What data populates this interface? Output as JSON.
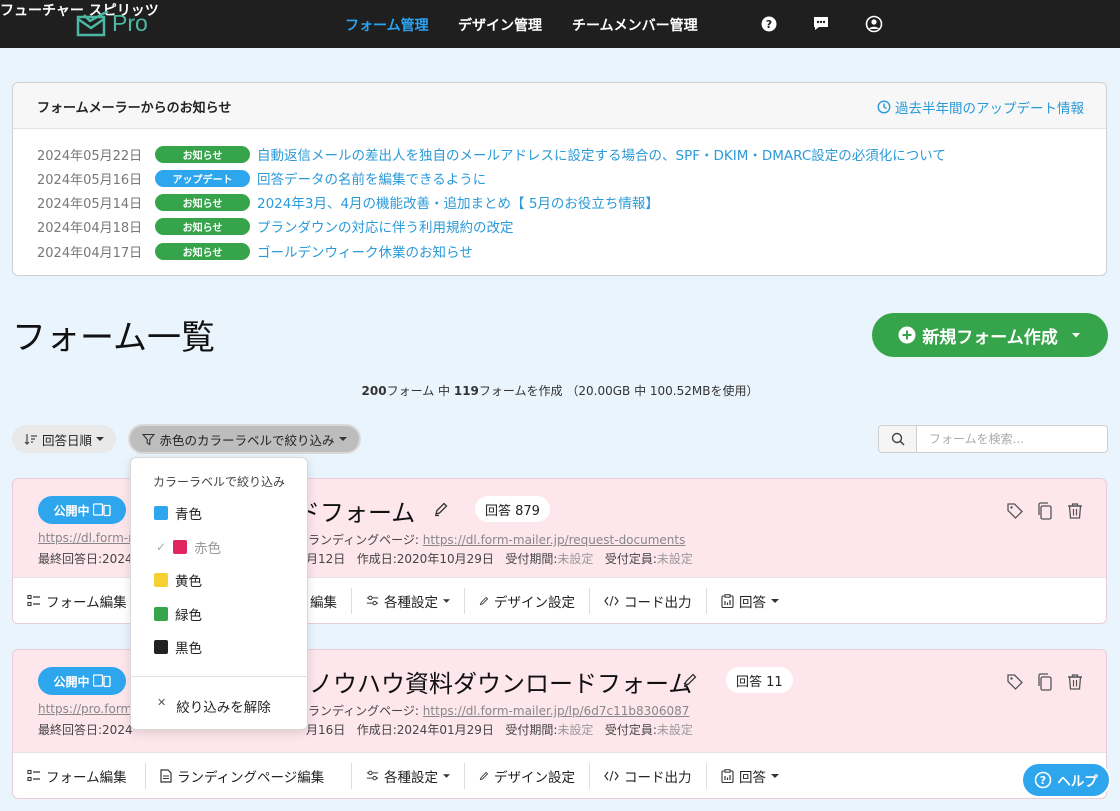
{
  "nav": {
    "logo_text": "Pro",
    "items": [
      "フォーム管理",
      "デザイン管理",
      "チームメンバー管理"
    ],
    "user_name": "フューチャー スピリッツ"
  },
  "news": {
    "title": "フォームメーラーからのお知らせ",
    "history_link": "過去半年間のアップデート情報",
    "items": [
      {
        "date": "2024年05月22日",
        "badge": "お知らせ",
        "text": "自動返信メールの差出人を独自のメールアドレスに設定する場合の、SPF・DKIM・DMARC設定の必須化について"
      },
      {
        "date": "2024年05月16日",
        "badge": "アップデート",
        "text": "回答データの名前を編集できるように"
      },
      {
        "date": "2024年05月14日",
        "badge": "お知らせ",
        "text": "2024年3月、4月の機能改善・追加まとめ【 5月のお役立ち情報】"
      },
      {
        "date": "2024年04月18日",
        "badge": "お知らせ",
        "text": "プランダウンの対応に伴う利用規約の改定"
      },
      {
        "date": "2024年04月17日",
        "badge": "お知らせ",
        "text": "ゴールデンウィーク休業のお知らせ"
      }
    ]
  },
  "list": {
    "title": "フォーム一覧",
    "new_button": "新規フォーム作成",
    "usage_total": "200",
    "usage_mid": "フォーム 中 ",
    "usage_used": "119",
    "usage_rest": "フォームを作成 （20.00GB 中 100.52MBを使用）"
  },
  "toolbar": {
    "sort_label": "回答日順",
    "filter_label": "赤色のカラーラベルで絞り込み",
    "search_placeholder": "フォームを検索..."
  },
  "dropdown": {
    "header": "カラーラベルで絞り込み",
    "items": [
      {
        "label": "青色",
        "color": "#2ea6ee"
      },
      {
        "label": "赤色",
        "color": "#e0245e",
        "checked": true
      },
      {
        "label": "黄色",
        "color": "#f5d033"
      },
      {
        "label": "緑色",
        "color": "#35a44a"
      },
      {
        "label": "黒色",
        "color": "#222222"
      }
    ],
    "clear": "絞り込みを解除"
  },
  "cards": [
    {
      "status": "公開中",
      "title": "ドフォーム",
      "responses": "回答 879",
      "url": "https://dl.form-m",
      "lp_label": "ランディングページ:",
      "lp_url": "https://dl.form-mailer.jp/request-documents",
      "last_answer": "最終回答日:2024",
      "updated": "月12日",
      "created": "作成日:2020年10月29日",
      "period_label": "受付期間:",
      "period_value": "未設定",
      "limit_label": "受付定員:",
      "limit_value": "未設定",
      "actions": [
        "フォーム編集",
        "編集",
        "各種設定",
        "デザイン設定",
        "コード出力",
        "回答"
      ]
    },
    {
      "status": "公開中",
      "title": "ノウハウ資料ダウンロードフォーム",
      "responses": "回答 11",
      "url": "https://pro.form-",
      "lp_label": "ランディングページ:",
      "lp_url": "https://dl.form-mailer.jp/lp/6d7c11b8306087",
      "last_answer": "最終回答日:2024",
      "updated": "月16日",
      "created": "作成日:2024年01月29日",
      "period_label": "受付期間:",
      "period_value": "未設定",
      "limit_label": "受付定員:",
      "limit_value": "未設定",
      "actions": [
        "フォーム編集",
        "ランディングページ編集",
        "各種設定",
        "デザイン設定",
        "コード出力",
        "回答"
      ]
    }
  ],
  "help_label": "ヘルプ",
  "colors": {
    "accent": "#2ba3f0",
    "green": "#35a44a",
    "card_bg": "#fde6ec"
  }
}
